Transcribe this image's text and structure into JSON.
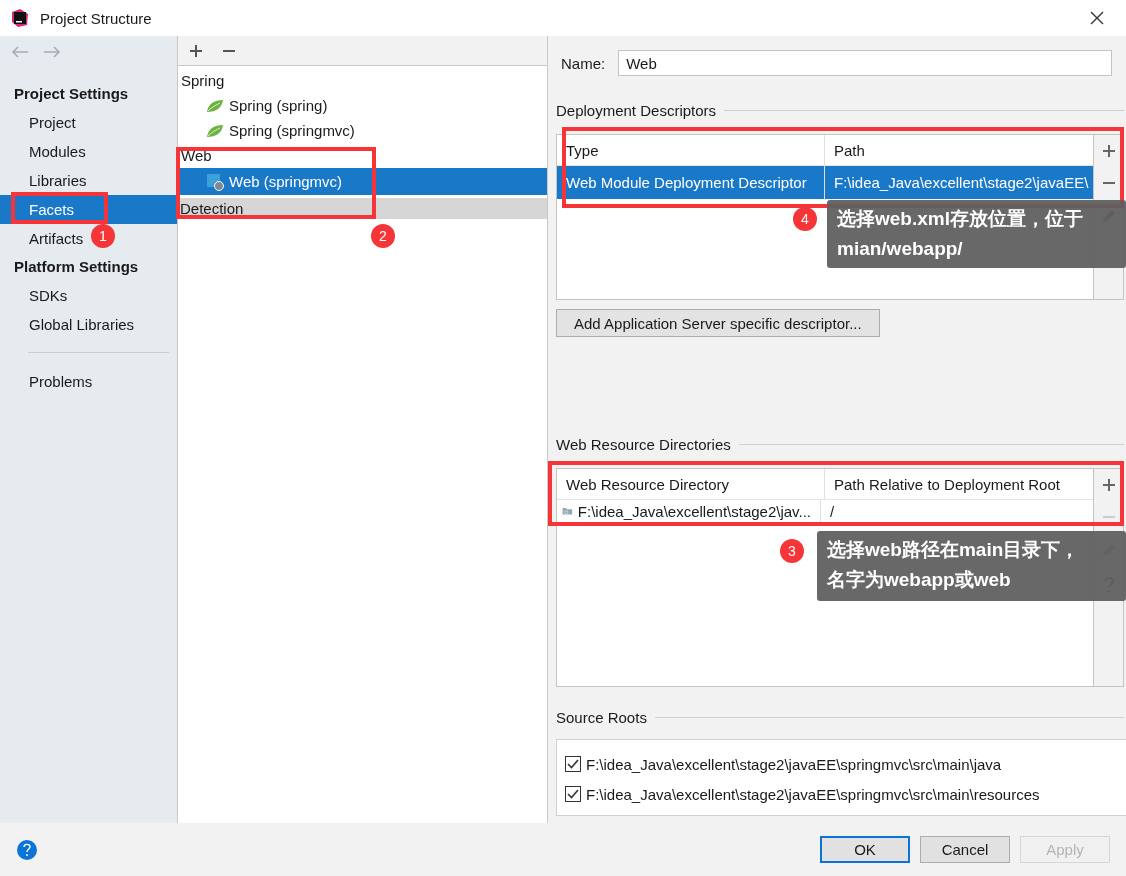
{
  "window": {
    "title": "Project Structure"
  },
  "sidebar": {
    "sections": [
      {
        "heading": "Project Settings",
        "items": [
          {
            "label": "Project",
            "selected": false
          },
          {
            "label": "Modules",
            "selected": false
          },
          {
            "label": "Libraries",
            "selected": false
          },
          {
            "label": "Facets",
            "selected": true
          },
          {
            "label": "Artifacts",
            "selected": false
          }
        ]
      },
      {
        "heading": "Platform Settings",
        "items": [
          {
            "label": "SDKs",
            "selected": false
          },
          {
            "label": "Global Libraries",
            "selected": false
          }
        ]
      }
    ],
    "bottom_items": [
      {
        "label": "Problems",
        "selected": false
      }
    ]
  },
  "facets_tree": {
    "groups": [
      {
        "label": "Spring",
        "children": [
          {
            "label": "Spring (spring)",
            "kind": "spring",
            "selected": false
          },
          {
            "label": "Spring (springmvc)",
            "kind": "spring",
            "selected": false
          }
        ]
      },
      {
        "label": "Web",
        "children": [
          {
            "label": "Web (springmvc)",
            "kind": "web",
            "selected": true
          }
        ]
      }
    ],
    "detection": "Detection"
  },
  "details": {
    "name_label": "Name:",
    "name_value": "Web",
    "deployment_descriptors": {
      "title": "Deployment Descriptors",
      "columns": [
        "Type",
        "Path"
      ],
      "rows": [
        {
          "cells": [
            "Web Module Deployment Descriptor",
            "F:\\idea_Java\\excellent\\stage2\\javaEE\\"
          ],
          "selected": true
        }
      ],
      "add_button": "Add Application Server specific descriptor..."
    },
    "web_resource_directories": {
      "title": "Web Resource Directories",
      "columns": [
        "Web Resource Directory",
        "Path Relative to Deployment Root"
      ],
      "rows": [
        {
          "cells": [
            "F:\\idea_Java\\excellent\\stage2\\jav...",
            "/"
          ],
          "selected": false
        }
      ]
    },
    "source_roots": {
      "title": "Source Roots",
      "items": [
        {
          "path": "F:\\idea_Java\\excellent\\stage2\\javaEE\\springmvc\\src\\main\\java",
          "checked": true
        },
        {
          "path": "F:\\idea_Java\\excellent\\stage2\\javaEE\\springmvc\\src\\main\\resources",
          "checked": true
        }
      ]
    }
  },
  "buttons": [
    {
      "label": "OK",
      "default": true,
      "disabled": false
    },
    {
      "label": "Cancel",
      "default": false,
      "disabled": false
    },
    {
      "label": "Apply",
      "default": false,
      "disabled": true
    }
  ],
  "annotations": [
    {
      "number": "1"
    },
    {
      "number": "2"
    },
    {
      "number": "4",
      "note": "选择web.xml存放位置，位于mian/webapp/"
    },
    {
      "number": "3",
      "note": "选择web路径在main目录下，名字为webapp或web"
    }
  ]
}
